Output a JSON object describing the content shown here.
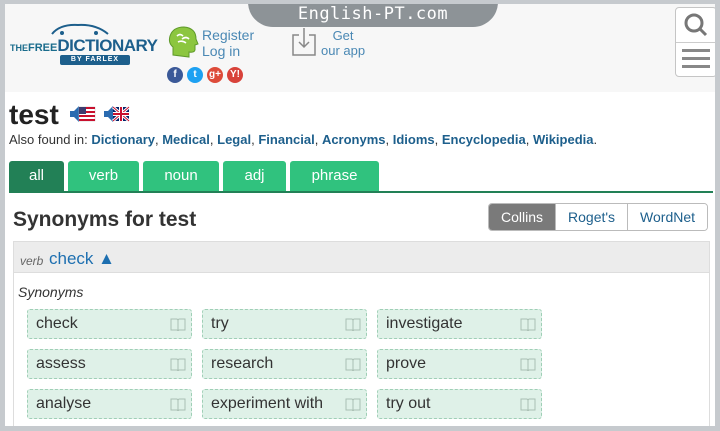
{
  "watermark": "English-PT.com",
  "header": {
    "logo": {
      "the": "THE",
      "free": "FREE",
      "dictionary": "DICTIONARY",
      "by": "BY FARLEX"
    },
    "register_label": "Register",
    "login_label": "Log in",
    "get_label": "Get",
    "our_app_label": "our app",
    "social": [
      {
        "name": "facebook-icon",
        "glyph": "f",
        "color": "#3b5998"
      },
      {
        "name": "twitter-icon",
        "glyph": "t",
        "color": "#1da1f2"
      },
      {
        "name": "google-plus-icon",
        "glyph": "g+",
        "color": "#dd4b39"
      },
      {
        "name": "yahoo-icon",
        "glyph": "Y!",
        "color": "#d8423a"
      }
    ]
  },
  "entry": {
    "word": "test",
    "also_found_label": "Also found in:",
    "also_found": [
      "Dictionary",
      "Medical",
      "Legal",
      "Financial",
      "Acronyms",
      "Idioms",
      "Encyclopedia",
      "Wikipedia"
    ]
  },
  "tabs": [
    {
      "label": "all",
      "active": true
    },
    {
      "label": "verb",
      "active": false
    },
    {
      "label": "noun",
      "active": false
    },
    {
      "label": "adj",
      "active": false
    },
    {
      "label": "phrase",
      "active": false
    }
  ],
  "synonyms": {
    "title": "Synonyms for test",
    "sources": [
      "Collins",
      "Roget's",
      "WordNet"
    ],
    "selected_source": "Collins",
    "pos": "verb",
    "sense": "check ▲",
    "label": "Synonyms",
    "words": [
      "check",
      "try",
      "investigate",
      "assess",
      "research",
      "prove",
      "analyse",
      "experiment with",
      "try out"
    ]
  }
}
